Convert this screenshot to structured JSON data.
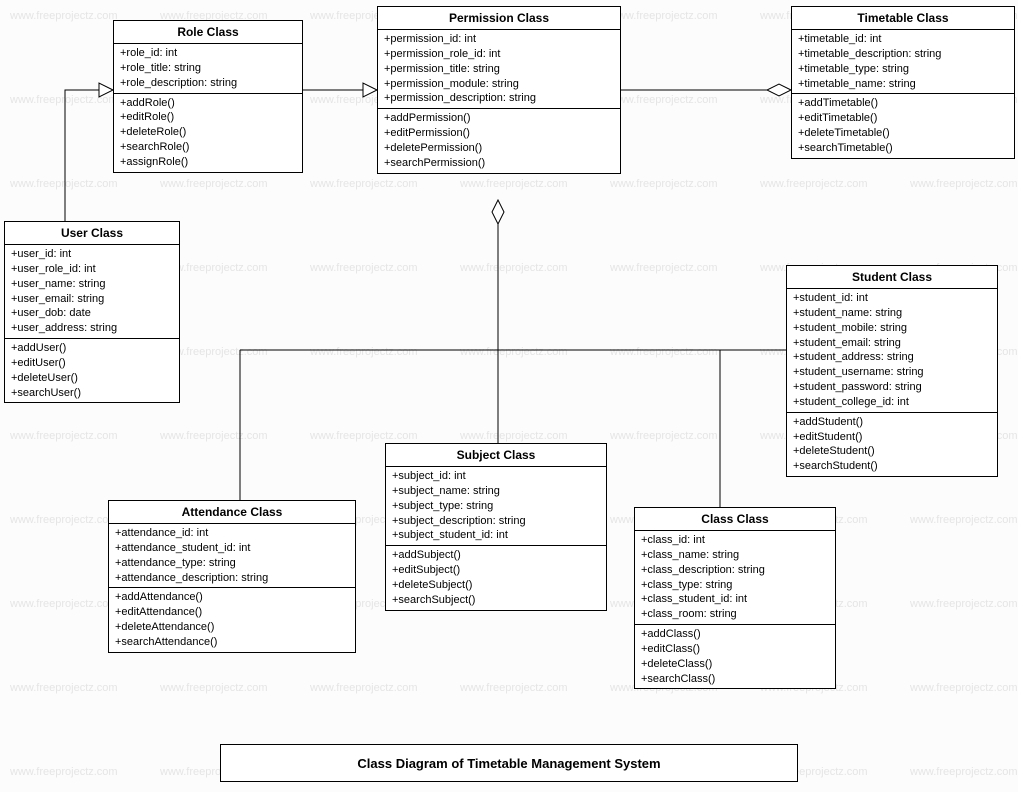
{
  "title": "Class Diagram of Timetable Management System",
  "watermark_text": "www.freeprojectz.com",
  "classes": {
    "role": {
      "name": "Role Class",
      "attributes": [
        "+role_id: int",
        "+role_title: string",
        "+role_description: string"
      ],
      "methods": [
        "+addRole()",
        "+editRole()",
        "+deleteRole()",
        "+searchRole()",
        "+assignRole()"
      ]
    },
    "permission": {
      "name": "Permission Class",
      "attributes": [
        "+permission_id: int",
        "+permission_role_id: int",
        "+permission_title: string",
        "+permission_module: string",
        "+permission_description: string"
      ],
      "methods": [
        "+addPermission()",
        "+editPermission()",
        "+deletePermission()",
        "+searchPermission()"
      ]
    },
    "timetable": {
      "name": "Timetable Class",
      "attributes": [
        "+timetable_id: int",
        "+timetable_description: string",
        "+timetable_type: string",
        "+timetable_name: string"
      ],
      "methods": [
        "+addTimetable()",
        "+editTimetable()",
        "+deleteTimetable()",
        "+searchTimetable()"
      ]
    },
    "user": {
      "name": "User Class",
      "attributes": [
        "+user_id: int",
        "+user_role_id: int",
        "+user_name: string",
        "+user_email: string",
        "+user_dob: date",
        "+user_address: string"
      ],
      "methods": [
        "+addUser()",
        "+editUser()",
        "+deleteUser()",
        "+searchUser()"
      ]
    },
    "student": {
      "name": "Student Class",
      "attributes": [
        "+student_id: int",
        "+student_name: string",
        "+student_mobile: string",
        "+student_email: string",
        "+student_address: string",
        "+student_username: string",
        "+student_password: string",
        "+student_college_id: int"
      ],
      "methods": [
        "+addStudent()",
        "+editStudent()",
        "+deleteStudent()",
        "+searchStudent()"
      ]
    },
    "subject": {
      "name": "Subject Class",
      "attributes": [
        "+subject_id: int",
        "+subject_name: string",
        "+subject_type: string",
        "+subject_description: string",
        "+subject_student_id: int"
      ],
      "methods": [
        "+addSubject()",
        "+editSubject()",
        "+deleteSubject()",
        "+searchSubject()"
      ]
    },
    "attendance": {
      "name": "Attendance Class",
      "attributes": [
        "+attendance_id: int",
        "+attendance_student_id: int",
        "+attendance_type: string",
        "+attendance_description: string"
      ],
      "methods": [
        "+addAttendance()",
        "+editAttendance()",
        "+deleteAttendance()",
        "+searchAttendance()"
      ]
    },
    "classclass": {
      "name": "Class Class",
      "attributes": [
        "+class_id: int",
        "+class_name: string",
        "+class_description: string",
        "+class_type: string",
        "+class_student_id: int",
        "+class_room: string"
      ],
      "methods": [
        "+addClass()",
        "+editClass()",
        "+deleteClass()",
        "+searchClass()"
      ]
    }
  }
}
